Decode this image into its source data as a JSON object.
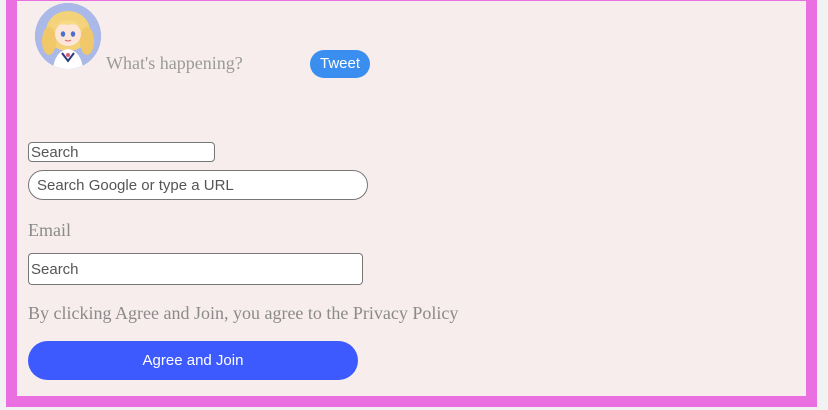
{
  "composer": {
    "placeholder": "What's happening?",
    "tweet_label": "Tweet"
  },
  "search_small": {
    "placeholder": "Search"
  },
  "search_url": {
    "placeholder": "Search Google or type a URL"
  },
  "signup": {
    "email_label": "Email",
    "email_placeholder": "Search",
    "terms_text": "By clicking Agree and Join, you agree to the Privacy Policy",
    "agree_label": "Agree and Join"
  },
  "colors": {
    "frame_border": "#ea6fe0",
    "frame_background": "#f7eded",
    "tweet_button": "#3a8ef0",
    "agree_button": "#3d5afe"
  },
  "icons": {
    "avatar": "anime-character-avatar"
  }
}
